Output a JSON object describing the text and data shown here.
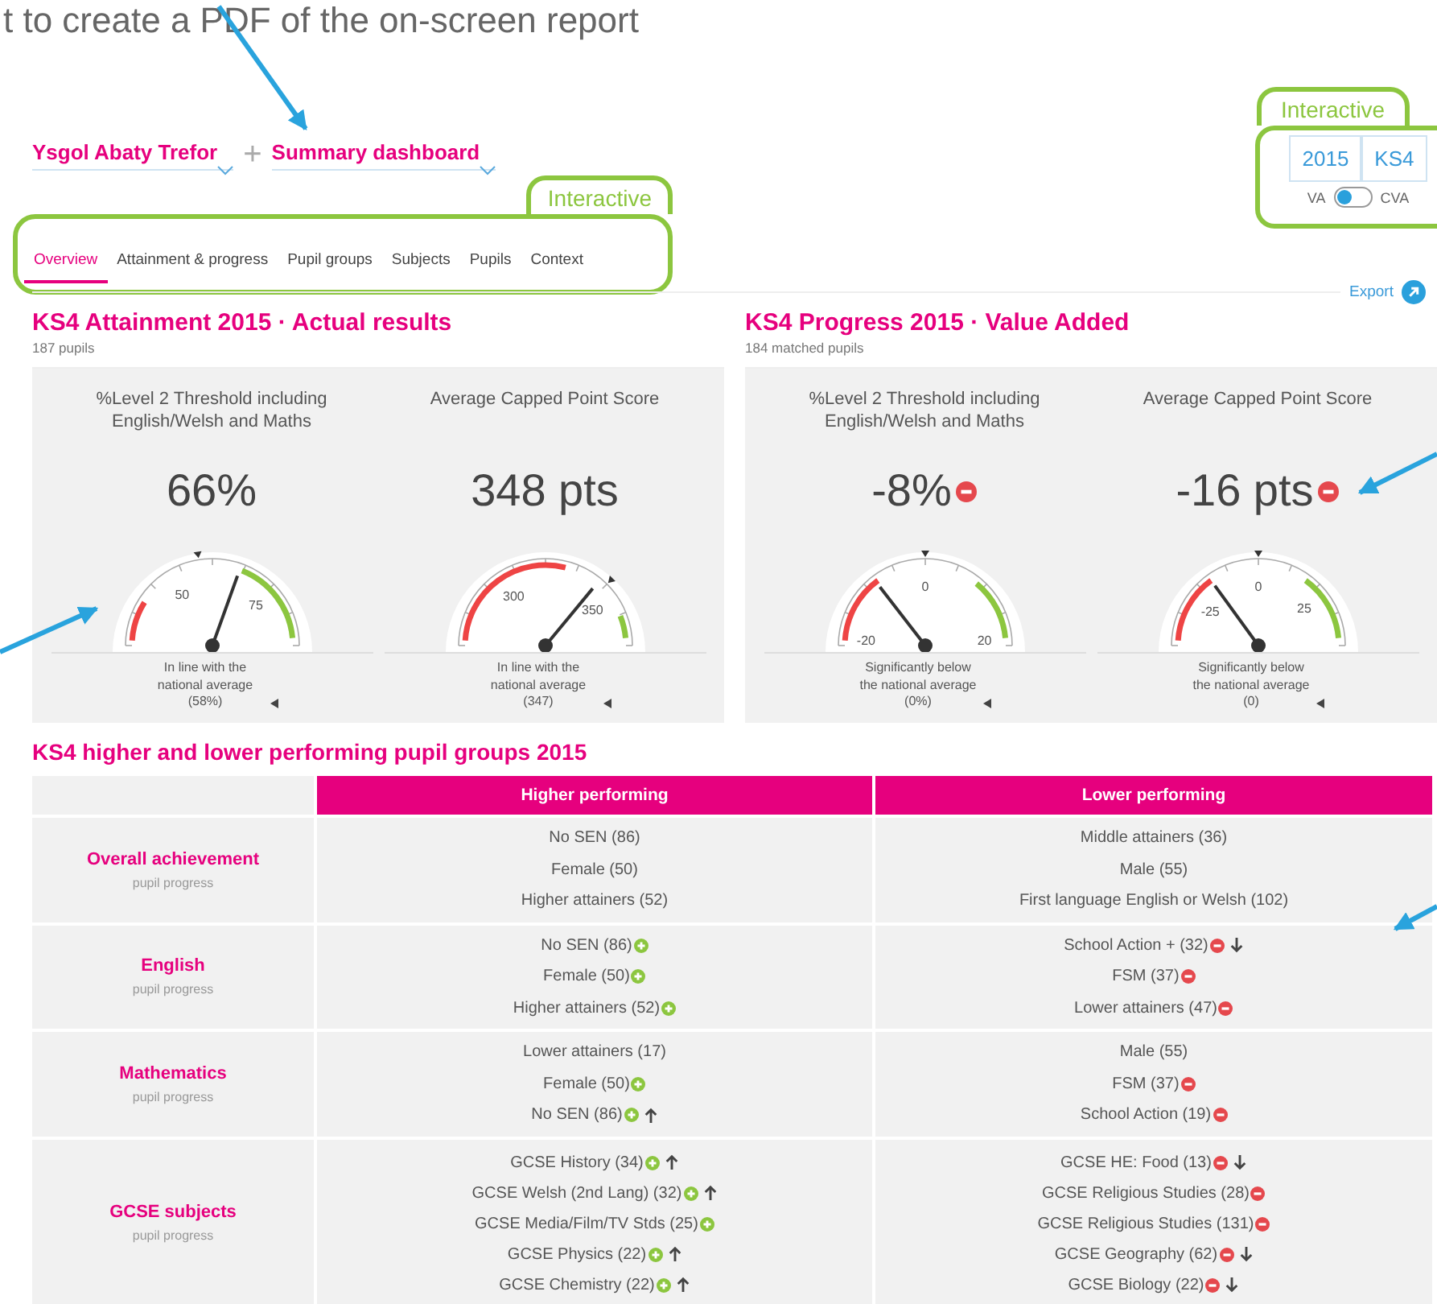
{
  "note": "t to create a PDF of the on-screen report",
  "header": {
    "school": "Ysgol Abaty Trefor",
    "separator": "+",
    "report": "Summary dashboard"
  },
  "tabs": {
    "callout": "Interactive",
    "items": [
      {
        "label": "Overview",
        "selected": true
      },
      {
        "label": "Attainment & progress",
        "selected": false
      },
      {
        "label": "Pupil groups",
        "selected": false
      },
      {
        "label": "Subjects",
        "selected": false
      },
      {
        "label": "Pupils",
        "selected": false
      },
      {
        "label": "Context",
        "selected": false
      }
    ]
  },
  "filters": {
    "callout": "Interactive",
    "options": [
      {
        "label": "2015"
      },
      {
        "label": "KS4"
      }
    ],
    "toggle": {
      "left": "VA",
      "right": "CVA",
      "on": false
    }
  },
  "export": "Export",
  "panels": [
    {
      "title": "KS4 Attainment 2015 · Actual results",
      "subtitle": "187 pupils",
      "gauges": [
        {
          "title": "%Level 2 Threshold including English/Welsh and Maths",
          "value": "66%",
          "significantly_below": false,
          "ticks": [
            "50",
            "75"
          ],
          "caption": "In line with the national average (58%)"
        },
        {
          "title": "Average Capped Point Score",
          "value": "348 pts",
          "significantly_below": false,
          "ticks": [
            "300",
            "350"
          ],
          "caption": "In line with the national average (347)"
        }
      ]
    },
    {
      "title": "KS4 Progress 2015 · Value Added",
      "subtitle": "184 matched pupils",
      "gauges": [
        {
          "title": "%Level 2 Threshold including English/Welsh and Maths",
          "value": "-8%",
          "significantly_below": true,
          "ticks": [
            "-20",
            "0",
            "20"
          ],
          "caption": "Significantly below the national average (0%)"
        },
        {
          "title": "Average Capped Point Score",
          "value": "-16 pts",
          "significantly_below": true,
          "ticks": [
            "-25",
            "0",
            "25"
          ],
          "caption": "Significantly below the national average (0)"
        }
      ]
    }
  ],
  "groups_table": {
    "title": "KS4 higher and lower performing pupil groups 2015",
    "columns": [
      "Higher performing",
      "Lower performing"
    ],
    "rows": [
      {
        "title": "Overall achievement",
        "subtitle": "pupil progress",
        "higher": [
          {
            "text": "No SEN (86)",
            "significant": false,
            "trend": false
          },
          {
            "text": "Female (50)",
            "significant": false,
            "trend": false
          },
          {
            "text": "Higher attainers (52)",
            "significant": false,
            "trend": false
          }
        ],
        "lower": [
          {
            "text": "Middle attainers (36)",
            "significant": false,
            "trend": false
          },
          {
            "text": "Male (55)",
            "significant": false,
            "trend": false
          },
          {
            "text": "First language English or Welsh (102)",
            "significant": false,
            "trend": false
          }
        ]
      },
      {
        "title": "English",
        "subtitle": "pupil progress",
        "higher": [
          {
            "text": "No SEN (86)",
            "significant": true,
            "trend": false
          },
          {
            "text": "Female (50)",
            "significant": true,
            "trend": false
          },
          {
            "text": "Higher attainers (52)",
            "significant": true,
            "trend": false
          }
        ],
        "lower": [
          {
            "text": "School Action + (32)",
            "significant": true,
            "trend": true
          },
          {
            "text": "FSM (37)",
            "significant": true,
            "trend": false
          },
          {
            "text": "Lower attainers (47)",
            "significant": true,
            "trend": false
          }
        ]
      },
      {
        "title": "Mathematics",
        "subtitle": "pupil progress",
        "higher": [
          {
            "text": "Lower attainers (17)",
            "significant": false,
            "trend": false
          },
          {
            "text": "Female (50)",
            "significant": true,
            "trend": false
          },
          {
            "text": "No SEN (86)",
            "significant": true,
            "trend": true
          }
        ],
        "lower": [
          {
            "text": "Male (55)",
            "significant": false,
            "trend": false
          },
          {
            "text": "FSM (37)",
            "significant": true,
            "trend": false
          },
          {
            "text": "School Action (19)",
            "significant": true,
            "trend": false
          }
        ]
      },
      {
        "title": "GCSE subjects",
        "subtitle": "pupil progress",
        "higher": [
          {
            "text": "GCSE History (34)",
            "significant": true,
            "trend": true
          },
          {
            "text": "GCSE Welsh (2nd Lang) (32)",
            "significant": true,
            "trend": true
          },
          {
            "text": "GCSE Media/Film/TV Stds (25)",
            "significant": true,
            "trend": false
          },
          {
            "text": "GCSE Physics (22)",
            "significant": true,
            "trend": true
          },
          {
            "text": "GCSE Chemistry (22)",
            "significant": true,
            "trend": true
          }
        ],
        "lower": [
          {
            "text": "GCSE HE: Food (13)",
            "significant": true,
            "trend": true
          },
          {
            "text": "GCSE Religious Studies (28)",
            "significant": true,
            "trend": false
          },
          {
            "text": "GCSE Religious Studies (131)",
            "significant": true,
            "trend": false
          },
          {
            "text": "GCSE Geography (62)",
            "significant": true,
            "trend": true
          },
          {
            "text": "GCSE Biology (22)",
            "significant": true,
            "trend": true
          }
        ]
      }
    ]
  }
}
